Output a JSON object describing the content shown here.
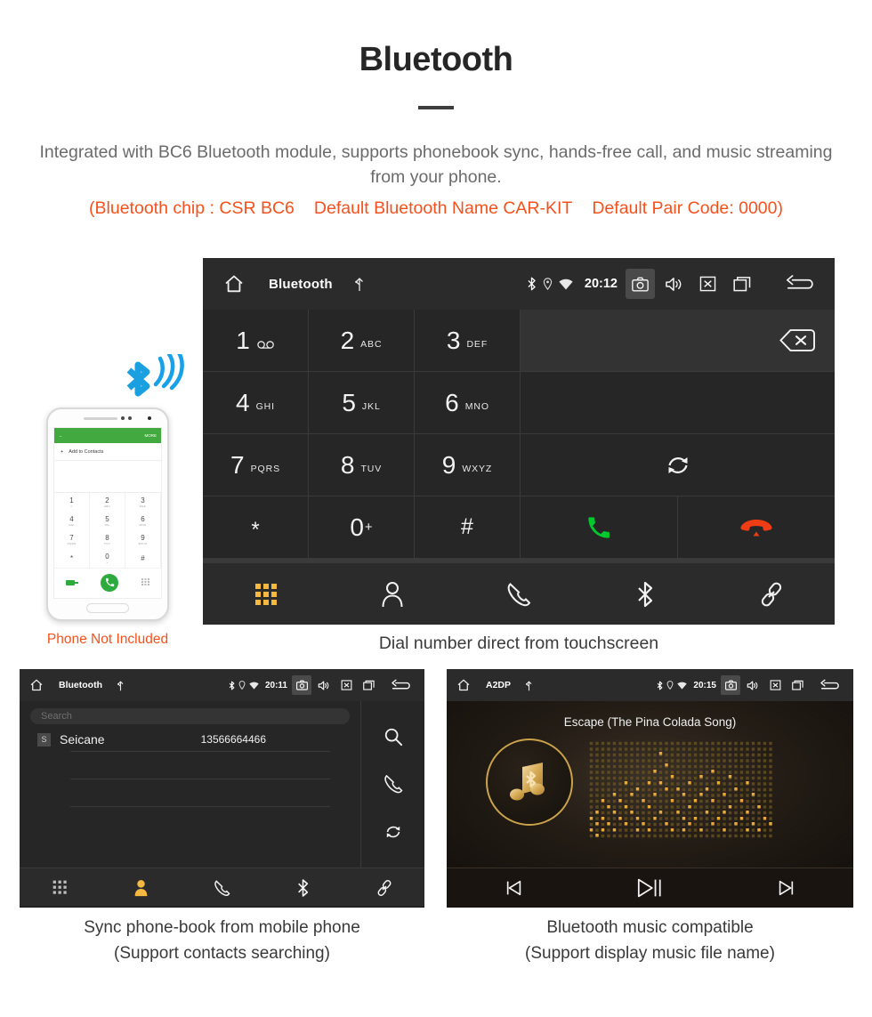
{
  "header": {
    "title": "Bluetooth",
    "description": "Integrated with BC6 Bluetooth module, supports phonebook sync, hands-free call, and music streaming from your phone.",
    "spec_open": "(Bluetooth chip : CSR BC6",
    "spec_name": "Default Bluetooth Name CAR-KIT",
    "spec_pair": "Default Pair Code: 0000)",
    "accent_color": "#f4511e",
    "text_color": "#6b6b6b"
  },
  "dialer": {
    "statusbar": {
      "home_icon": "home-icon",
      "title": "Bluetooth",
      "usb_icon": "usb-icon",
      "bluetooth_icon": "bluetooth-icon",
      "location_icon": "location-icon",
      "wifi_icon": "wifi-icon",
      "time": "20:12",
      "camera_icon": "camera-icon",
      "volume_icon": "volume-icon",
      "mute_icon": "mute-x-icon",
      "recents_icon": "recents-icon",
      "back_icon": "back-arrow-icon"
    },
    "keys": [
      {
        "num": "1",
        "sub": "",
        "voicemail": "∞"
      },
      {
        "num": "2",
        "sub": "ABC"
      },
      {
        "num": "3",
        "sub": "DEF"
      },
      {
        "num": "4",
        "sub": "GHI"
      },
      {
        "num": "5",
        "sub": "JKL"
      },
      {
        "num": "6",
        "sub": "MNO"
      },
      {
        "num": "7",
        "sub": "PQRS"
      },
      {
        "num": "8",
        "sub": "TUV"
      },
      {
        "num": "9",
        "sub": "WXYZ"
      },
      {
        "num": "*",
        "sub": ""
      },
      {
        "num": "0",
        "sub": "",
        "plus": "+"
      },
      {
        "num": "#",
        "sub": ""
      }
    ],
    "number_display_value": "",
    "backspace_icon": "backspace-icon",
    "sync_icon": "sync-icon",
    "call_icon": "call-green-icon",
    "endcall_icon": "end-call-red-icon",
    "call_color": "#00c92e",
    "endcall_color": "#ee3c14",
    "nav": [
      {
        "icon": "keypad-icon",
        "label": "Keypad",
        "active": true
      },
      {
        "icon": "contacts-person-icon",
        "label": "Contacts",
        "active": false
      },
      {
        "icon": "call-log-icon",
        "label": "Call log",
        "active": false
      },
      {
        "icon": "bluetooth-icon",
        "label": "Bluetooth",
        "active": false
      },
      {
        "icon": "link-pair-icon",
        "label": "Pair",
        "active": false
      }
    ],
    "active_color": "#f5b942",
    "caption": "Dial number direct from touchscreen"
  },
  "phone_mockup": {
    "screen_header_back": "←",
    "screen_header_more": "MORE",
    "add_contacts_label": "Add to Contacts",
    "keys": [
      {
        "num": "1",
        "sub": "∞"
      },
      {
        "num": "2",
        "sub": "ABC"
      },
      {
        "num": "3",
        "sub": "DEF"
      },
      {
        "num": "4",
        "sub": "GHI"
      },
      {
        "num": "5",
        "sub": "JKL"
      },
      {
        "num": "6",
        "sub": "MNO"
      },
      {
        "num": "7",
        "sub": "PQRS"
      },
      {
        "num": "8",
        "sub": "TUV"
      },
      {
        "num": "9",
        "sub": "WXYZ"
      },
      {
        "num": "*",
        "sub": ""
      },
      {
        "num": "0",
        "sub": "+"
      },
      {
        "num": "#",
        "sub": ""
      }
    ],
    "caption": "Phone Not Included",
    "caption_color": "#f4511e",
    "bluetooth_signal_color": "#18a0e8"
  },
  "phonebook": {
    "statusbar": {
      "title": "Bluetooth",
      "time": "20:11"
    },
    "search_placeholder": "Search",
    "contacts": [
      {
        "initial": "S",
        "name": "Seicane",
        "number": "13566664466"
      }
    ],
    "side_actions": [
      {
        "icon": "search-icon",
        "label": "Search"
      },
      {
        "icon": "call-icon",
        "label": "Call"
      },
      {
        "icon": "sync-icon",
        "label": "Sync"
      }
    ],
    "nav": [
      {
        "icon": "keypad-icon",
        "active": false
      },
      {
        "icon": "contacts-person-icon",
        "active": true
      },
      {
        "icon": "call-log-icon",
        "active": false
      },
      {
        "icon": "bluetooth-icon",
        "active": false
      },
      {
        "icon": "link-pair-icon",
        "active": false
      }
    ],
    "caption_line1": "Sync phone-book from mobile phone",
    "caption_line2": "(Support contacts searching)"
  },
  "music": {
    "statusbar": {
      "title": "A2DP",
      "time": "20:15"
    },
    "track_title": "Escape (The Pina Colada Song)",
    "album_icon": "music-note-bluetooth-icon",
    "visualizer_icon": "spectrum-dot-matrix",
    "accent_color": "#caa24a",
    "controls": [
      {
        "icon": "previous-track-icon",
        "label": "Previous"
      },
      {
        "icon": "play-pause-icon",
        "label": "Play / Pause"
      },
      {
        "icon": "next-track-icon",
        "label": "Next"
      }
    ],
    "caption_line1": "Bluetooth music compatible",
    "caption_line2": "(Support display music file name)"
  }
}
